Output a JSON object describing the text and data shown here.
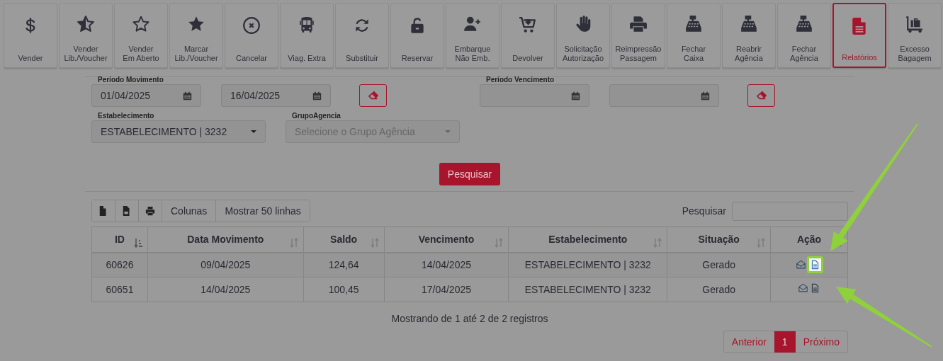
{
  "toolbar": [
    {
      "lines": [
        "Vender"
      ],
      "selected": false
    },
    {
      "lines": [
        "Vender",
        "Lib./Voucher"
      ],
      "selected": false
    },
    {
      "lines": [
        "Vender",
        "Em Aberto"
      ],
      "selected": false
    },
    {
      "lines": [
        "Marcar",
        "Lib./Voucher"
      ],
      "selected": false
    },
    {
      "lines": [
        "Cancelar"
      ],
      "selected": false
    },
    {
      "lines": [
        "Viag. Extra"
      ],
      "selected": false
    },
    {
      "lines": [
        "Substituir"
      ],
      "selected": false
    },
    {
      "lines": [
        "Reservar"
      ],
      "selected": false
    },
    {
      "lines": [
        "Embarque",
        "Não Emb."
      ],
      "selected": false
    },
    {
      "lines": [
        "Devolver"
      ],
      "selected": false
    },
    {
      "lines": [
        "Solicitação",
        "Autorização"
      ],
      "selected": false
    },
    {
      "lines": [
        "Reimpressão",
        "Passagem"
      ],
      "selected": false
    },
    {
      "lines": [
        "Fechar",
        "Caixa"
      ],
      "selected": false
    },
    {
      "lines": [
        "Reabrir",
        "Agência"
      ],
      "selected": false
    },
    {
      "lines": [
        "Fechar",
        "Agência"
      ],
      "selected": false
    },
    {
      "lines": [
        "Relatórios"
      ],
      "selected": true
    },
    {
      "lines": [
        "Excesso",
        "Bagagem"
      ],
      "selected": false
    }
  ],
  "periodo_movimento": {
    "label": "Período Movimento",
    "from": "01/04/2025",
    "to": "16/04/2025"
  },
  "periodo_vencimento": {
    "label": "Período Vencimento"
  },
  "estabelecimento": {
    "label": "Estabelecimento",
    "value": "ESTABELECIMENTO | 3232"
  },
  "grupo_agencia": {
    "label": "GrupoAgencia",
    "placeholder": "Selecione o Grupo Agência"
  },
  "search_button": "Pesquisar",
  "table_tools": [
    {
      "kind": "icon"
    },
    {
      "kind": "icon"
    },
    {
      "kind": "icon"
    },
    {
      "kind": "text",
      "label": "Colunas"
    },
    {
      "kind": "text",
      "label": "Mostrar 50 linhas"
    }
  ],
  "search_label": "Pesquisar",
  "table": {
    "columns": [
      {
        "label": "ID",
        "sorted": true
      },
      {
        "label": "Data Movimento",
        "sorted": false
      },
      {
        "label": "Saldo",
        "sorted": false
      },
      {
        "label": "Vencimento",
        "sorted": false
      },
      {
        "label": "Estabelecimento",
        "sorted": false
      },
      {
        "label": "Situação",
        "sorted": false
      },
      {
        "label": "Ação",
        "sorted": false
      }
    ],
    "rows": [
      {
        "cells": [
          "60626",
          "09/04/2025",
          "124,64",
          "14/04/2025",
          "ESTABELECIMENTO | 3232",
          "Gerado"
        ],
        "actions": [
          {
            "highlighted": false
          },
          {
            "highlighted": true
          }
        ]
      },
      {
        "cells": [
          "60651",
          "14/04/2025",
          "100,45",
          "17/04/2025",
          "ESTABELECIMENTO | 3232",
          "Gerado"
        ],
        "actions": [
          {
            "highlighted": false
          },
          {
            "highlighted": false
          }
        ]
      }
    ]
  },
  "info": "Mostrando de 1 até 2 de 2 registros",
  "pagination": [
    {
      "label": "Anterior",
      "selected": false
    },
    {
      "label": "1",
      "selected": true
    },
    {
      "label": "Próximo",
      "selected": false
    }
  ],
  "callout_arrows": [
    {
      "kind": "arrow"
    },
    {
      "kind": "arrow"
    }
  ]
}
